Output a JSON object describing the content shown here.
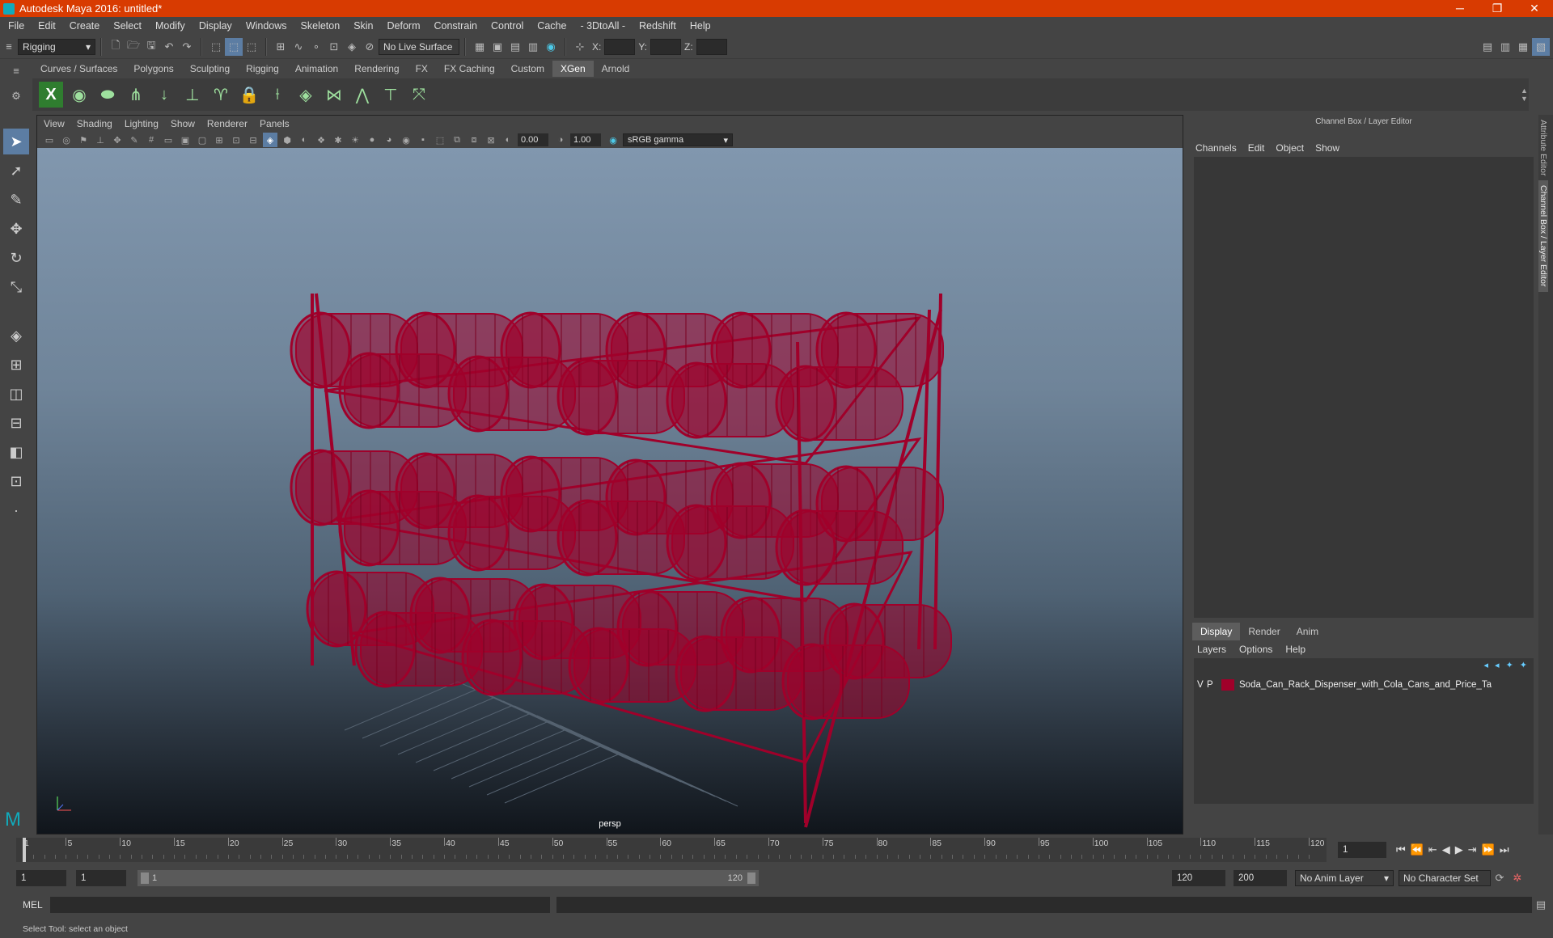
{
  "window": {
    "title": "Autodesk Maya 2016: untitled*",
    "controls": [
      "─",
      "❐",
      "✕"
    ]
  },
  "menus": [
    "File",
    "Edit",
    "Create",
    "Select",
    "Modify",
    "Display",
    "Windows",
    "Skeleton",
    "Skin",
    "Deform",
    "Constrain",
    "Control",
    "Cache",
    "- 3DtoAll -",
    "Redshift",
    "Help"
  ],
  "status": {
    "mode": "Rigging",
    "live_surface": "No Live Surface",
    "x_label": "X:",
    "y_label": "Y:",
    "z_label": "Z:"
  },
  "shelf": {
    "tabs": [
      "Curves / Surfaces",
      "Polygons",
      "Sculpting",
      "Rigging",
      "Animation",
      "Rendering",
      "FX",
      "FX Caching",
      "Custom",
      "XGen",
      "Arnold"
    ],
    "active_tab": "XGen"
  },
  "viewport": {
    "menus": [
      "View",
      "Shading",
      "Lighting",
      "Show",
      "Renderer",
      "Panels"
    ],
    "exposure": "0.00",
    "gamma": "1.00",
    "color_space": "sRGB gamma",
    "camera_label": "persp",
    "wire_color": "#a0002a"
  },
  "channel_box": {
    "title": "Channel Box / Layer Editor",
    "menus": [
      "Channels",
      "Edit",
      "Object",
      "Show"
    ],
    "layer_tabs": [
      "Display",
      "Render",
      "Anim"
    ],
    "active_layer_tab": "Display",
    "layer_menus": [
      "Layers",
      "Options",
      "Help"
    ],
    "layer": {
      "v": "V",
      "p": "P",
      "name": "Soda_Can_Rack_Dispenser_with_Cola_Cans_and_Price_Ta"
    }
  },
  "side_tabs": [
    "Attribute Editor",
    "Channel Box / Layer Editor"
  ],
  "timeline": {
    "ticks": [
      1,
      5,
      10,
      15,
      20,
      25,
      30,
      35,
      40,
      45,
      50,
      55,
      60,
      65,
      70,
      75,
      80,
      85,
      90,
      95,
      100,
      105,
      110,
      115,
      120
    ],
    "current_frame": "1"
  },
  "range": {
    "start": "1",
    "playback_start": "1",
    "slider_start": "1",
    "slider_end": "120",
    "playback_end": "120",
    "end": "200",
    "anim_layer": "No Anim Layer",
    "character_set": "No Character Set"
  },
  "command": {
    "label": "MEL"
  },
  "help_line": "Select Tool: select an object"
}
